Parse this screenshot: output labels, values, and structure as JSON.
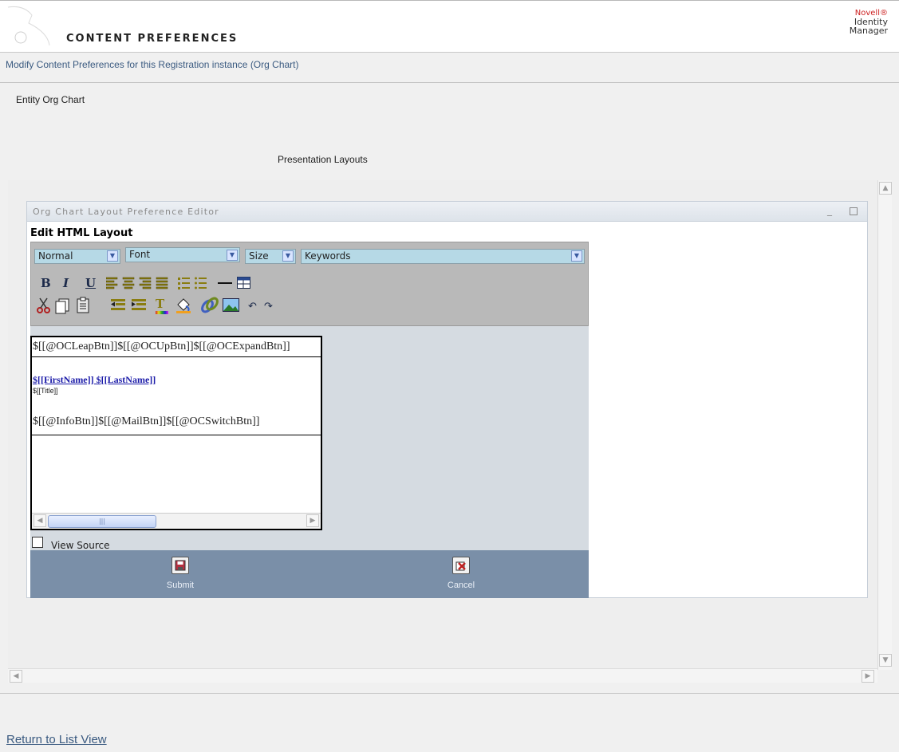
{
  "header": {
    "title": "CONTENT PREFERENCES",
    "brand_line1": "Novell®",
    "brand_line2": "Identity",
    "brand_line3": "Manager"
  },
  "subtitle": "Modify Content Preferences for this Registration instance (Org Chart)",
  "entity_label": "Entity Org Chart",
  "presentation_label": "Presentation Layouts",
  "portlet": {
    "title": "Org Chart Layout Preference Editor",
    "minimize": "_",
    "editor_heading": "Edit HTML Layout",
    "toolbar": {
      "format_select": "Normal",
      "font_select": "Font",
      "size_select": "Size",
      "keywords_select": "Keywords",
      "bold": "B",
      "italic": "I",
      "underline": "U",
      "text_color": "T"
    },
    "content": {
      "line1": "$[[@OCLeapBtn]]$[[@OCUpBtn]]$[[@OCExpandBtn]]",
      "name": "$[[FirstName]] $[[LastName]]",
      "title": "$[[Title]]",
      "line2": "$[[@InfoBtn]]$[[@MailBtn]]$[[@OCSwitchBtn]]"
    },
    "view_source_label": "View Source",
    "submit_label": "Submit",
    "cancel_label": "Cancel"
  },
  "return_link": "Return to List View"
}
